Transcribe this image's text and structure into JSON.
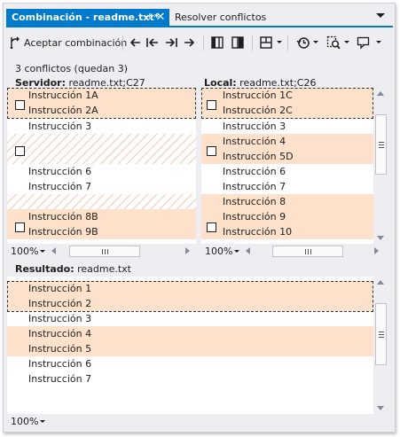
{
  "tabs": {
    "active_label": "Combinación - readme.txt*",
    "pin_glyph": "⊣",
    "close_glyph": "✕",
    "inactive_label": "Resolver conflictos"
  },
  "toolbar": {
    "accept_label": "Aceptar combinación",
    "icons": [
      "accept-merge-icon",
      "prev-conflict-icon",
      "first-conflict-icon",
      "last-conflict-icon",
      "next-conflict-icon",
      "vertical-layout-icon",
      "side-by-side-icon",
      "layout-options-icon",
      "history-icon",
      "compare-icon",
      "comment-icon"
    ]
  },
  "status": {
    "conflicts_text": "3 conflictos (quedan 3)"
  },
  "server": {
    "header_bold": "Servidor:",
    "header_rest": " readme.txt;C27",
    "zoom": "100%",
    "lines": [
      "Instrucción 1A",
      "Instrucción 2A",
      "Instrucción 3",
      "",
      "",
      "Instrucción 6",
      "Instrucción 7",
      "",
      "Instrucción 8B",
      "Instrucción 9B"
    ]
  },
  "local": {
    "header_bold": "Local:",
    "header_rest": " readme.txt;C26",
    "zoom": "100%",
    "lines": [
      "Instrucción 1C",
      "Instrucción 2C",
      "Instrucción 3",
      "Instrucción 4",
      "Instrucción 5D",
      "Instrucción 6",
      "Instrucción 7",
      "Instrucción 8",
      "Instrucción 9",
      "Instrucción 10"
    ]
  },
  "result": {
    "header_bold": "Resultado:",
    "header_rest": " readme.txt",
    "zoom": "100%",
    "lines": [
      "Instrucción 1",
      "Instrucción 2",
      "Instrucción 3",
      "Instrucción 4",
      "Instrucción 5",
      "Instrucción 6",
      "Instrucción 7"
    ]
  },
  "colors": {
    "accent": "#007acc",
    "conflict_highlight": "#fde1cb",
    "hatch": "#f7c8b4",
    "chrome": "#eeeef2"
  }
}
